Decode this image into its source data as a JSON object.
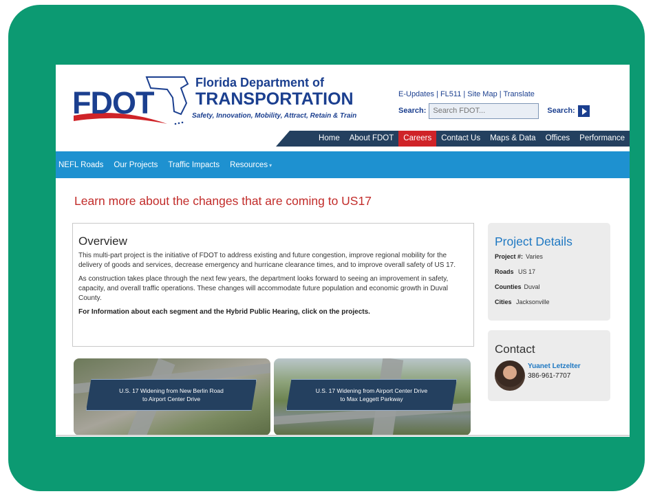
{
  "header": {
    "logo_text": "FDOT",
    "org_line1": "Florida Department of",
    "org_line2": "TRANSPORTATION",
    "tagline": "Safety, Innovation, Mobility, Attract, Retain & Train",
    "top_links": "E-Updates | FL511 | Site Map | Translate",
    "search_label": "Search:",
    "search_placeholder": "Search FDOT...",
    "search_button_label": "Search:"
  },
  "top_nav": [
    {
      "label": "Home"
    },
    {
      "label": "About FDOT"
    },
    {
      "label": "Careers"
    },
    {
      "label": "Contact Us"
    },
    {
      "label": "Maps & Data"
    },
    {
      "label": "Offices"
    },
    {
      "label": "Performance"
    }
  ],
  "sub_nav": [
    {
      "label": "NEFL Roads"
    },
    {
      "label": "Our Projects"
    },
    {
      "label": "Traffic Impacts"
    },
    {
      "label": "Resources"
    }
  ],
  "headline": "Learn more about the changes that are coming to US17",
  "overview": {
    "title": "Overview",
    "p1": "This multi-part project is the initiative of FDOT to address existing and future congestion, improve regional mobility for the delivery of goods and services, decrease emergency and hurricane clearance times, and to improve overall safety of US 17.",
    "p2": "As construction takes place through the next few years, the department looks forward to seeing an improvement in safety, capacity, and overall traffic operations. These changes will accommodate future population and economic growth in Duval County.",
    "p3": "For Information about each segment and the Hybrid Public Hearing, click on the projects."
  },
  "projects": [
    {
      "line1": "U.S. 17 Widening from New Berlin Road",
      "line2": "to Airport Center Drive"
    },
    {
      "line1": "U.S. 17 Widening from Airport Center Drive",
      "line2": "to Max Leggett Parkway"
    }
  ],
  "project_details": {
    "title": "Project Details",
    "project_label": "Project #:",
    "project_value": "Varies",
    "roads_label": "Roads",
    "roads_value": "US 17",
    "counties_label": "Counties",
    "counties_value": "Duval",
    "cities_label": "Cities",
    "cities_value": "Jacksonville"
  },
  "contact": {
    "title": "Contact",
    "name": "Yuanet Letzelter",
    "phone": "386-961-7707"
  },
  "colors": {
    "frame": "#0c9a72",
    "brand_blue": "#1b3f8f",
    "nav_dark": "#24405f",
    "active_red": "#cf2328",
    "subnav_blue": "#1e91d0",
    "headline_red": "#c22c2a"
  }
}
